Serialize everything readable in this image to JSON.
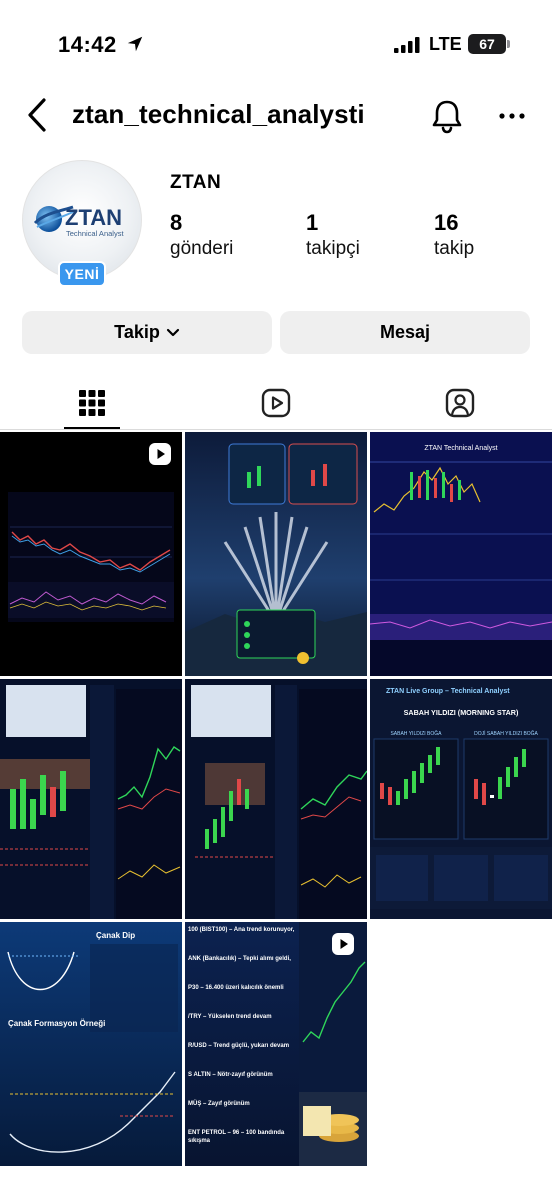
{
  "status_bar": {
    "time": "14:42",
    "network": "LTE",
    "battery": "67"
  },
  "header": {
    "username": "ztan_technical_analysti"
  },
  "profile": {
    "display_name": "ZTAN",
    "avatar_logo_text": "ZTAN",
    "avatar_logo_subtitle": "Technical Analyst",
    "new_badge": "YENİ",
    "stats": [
      {
        "value": "8",
        "label": "gönderi"
      },
      {
        "value": "1",
        "label": "takipçi"
      },
      {
        "value": "16",
        "label": "takip"
      }
    ]
  },
  "actions": {
    "follow_label": "Takip",
    "message_label": "Mesaj"
  },
  "tabs": [
    {
      "name": "posts",
      "icon": "grid-icon",
      "active": true
    },
    {
      "name": "reels",
      "icon": "reels-icon",
      "active": false
    },
    {
      "name": "tagged",
      "icon": "tagged-icon",
      "active": false
    }
  ],
  "posts": [
    {
      "type": "chart",
      "reel": true
    },
    {
      "type": "infographic-jets",
      "reel": false
    },
    {
      "type": "chart",
      "reel": false,
      "title": "ZTAN Technical Analyst"
    },
    {
      "type": "chart-table",
      "reel": false
    },
    {
      "type": "chart-table",
      "reel": false
    },
    {
      "type": "candlestick-infographic",
      "reel": false,
      "brand": "ZTAN Live Group – Technical Analyst",
      "title": "SABAH YILDIZI (MORNING STAR)",
      "left_label": "SABAH YILDIZI BOĞA",
      "right_label": "DOJİ SABAH YILDIZI BOĞA"
    },
    {
      "type": "pattern-infographic",
      "reel": false,
      "title": "Çanak Dip",
      "subtitle": "Çanak Formasyon Örneği"
    },
    {
      "type": "text-list",
      "reel": false,
      "lines": [
        "100 (BIST100) – Ana trend korunuyor,",
        "ANK (Bankacılık) – Tepki alımı geldi,",
        "P30 – 16.400 üzeri kalıcılık önemli",
        "/TRY – Yükselen trend devam",
        "R/USD – Trend güçlü, yukarı devam",
        "S ALTIN – Nötr-zayıf görünüm",
        "MÜŞ – Zayıf görünüm",
        "ENT PETROL – 96 – 100 bandında sıkışma"
      ]
    },
    {
      "type": "chart-coins",
      "reel": true
    }
  ],
  "colors": {
    "accent_blue": "#3a97ee",
    "button_bg": "#efefef",
    "divider": "#dbdbdb"
  }
}
